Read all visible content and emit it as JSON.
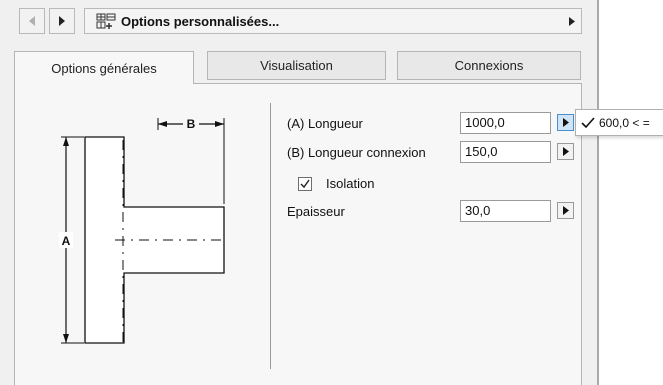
{
  "header": {
    "title": "Options personnalisées...",
    "icon": "settings-table-icon"
  },
  "tabs": [
    {
      "label": "Options générales",
      "active": true
    },
    {
      "label": "Visualisation",
      "active": false
    },
    {
      "label": "Connexions",
      "active": false
    }
  ],
  "diagram": {
    "label_a": "A",
    "label_b": "B"
  },
  "params": {
    "length_label": "(A) Longueur",
    "length_value": "1000,0",
    "connection_label": "(B) Longueur connexion",
    "connection_value": "150,0",
    "insulation_label": "Isolation",
    "insulation_checked": true,
    "thickness_label": "Epaisseur",
    "thickness_value": "30,0"
  },
  "popup": {
    "option_text": "600,0 < ="
  },
  "colors": {
    "panel_bg": "#f0f0f0",
    "active_arrow": "#cfe4f5"
  }
}
